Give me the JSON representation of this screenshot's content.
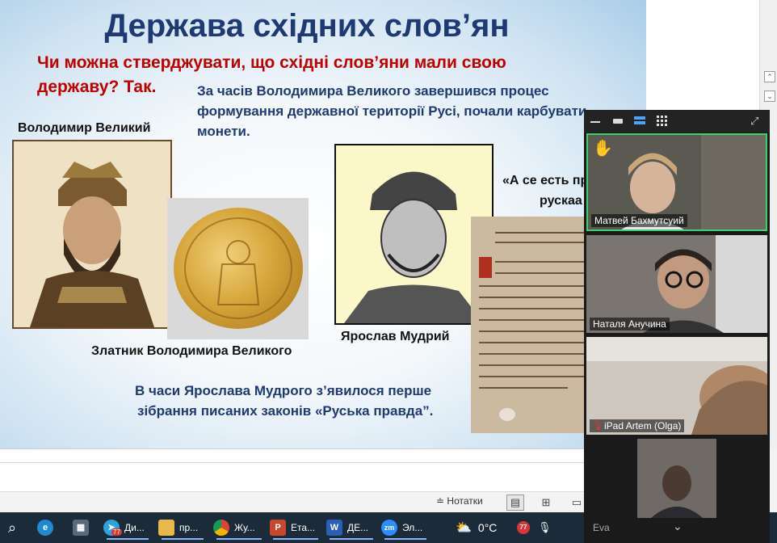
{
  "slide": {
    "title": "Держава східних слов’ян",
    "question_line1": "Чи можна стверджувати, що східні слов’яни мали свою",
    "question_line2": "державу? Так.",
    "para1_line1": "За часів Володимира Великого завершився процес",
    "para1_line2": "формування державної території  Русі, почали карбувати",
    "para1_line3": "монети.",
    "caption_volodymyr": "Володимир Великий",
    "caption_coin": "Златник Володимира Великого",
    "caption_yaroslav": "Ярослав Мудрий",
    "quote_line1": "«А се есть пр",
    "quote_line2": "рускаа",
    "para2_line1": "В  часи Ярослава Мудрого з’явилося перше",
    "para2_line2": "зібрання писаних законів «Руська правда”."
  },
  "status_bar": {
    "notes_label": "Нотатки"
  },
  "taskbar": {
    "items": [
      {
        "icon": "edge-icon",
        "label": ""
      },
      {
        "icon": "calculator-icon",
        "label": ""
      },
      {
        "icon": "telegram-icon",
        "label": "Ди...",
        "badge": "77"
      },
      {
        "icon": "folder-icon",
        "label": "пр..."
      },
      {
        "icon": "chrome-icon",
        "label": "Жу..."
      },
      {
        "icon": "powerpoint-icon",
        "label": "Ета..."
      },
      {
        "icon": "word-icon",
        "label": "ДЕ..."
      },
      {
        "icon": "zoom-icon",
        "label": "Эл..."
      }
    ],
    "weather": "0°C",
    "tray_badge": "77"
  },
  "zoom": {
    "participants": [
      {
        "name": "Матвей Бахмутсуий",
        "active": true,
        "raised_hand": true,
        "muted": false
      },
      {
        "name": "Наталя Анучина",
        "active": false,
        "raised_hand": false,
        "muted": false
      },
      {
        "name": "iPad Artem (Olga)",
        "active": false,
        "raised_hand": false,
        "muted": true
      },
      {
        "name": "Eva",
        "active": false,
        "raised_hand": false,
        "muted": false
      }
    ]
  },
  "colors": {
    "title": "#1f3a73",
    "question": "#c00000",
    "zoom_active_border": "#3dd16b",
    "taskbar": "#1c2b3a"
  }
}
